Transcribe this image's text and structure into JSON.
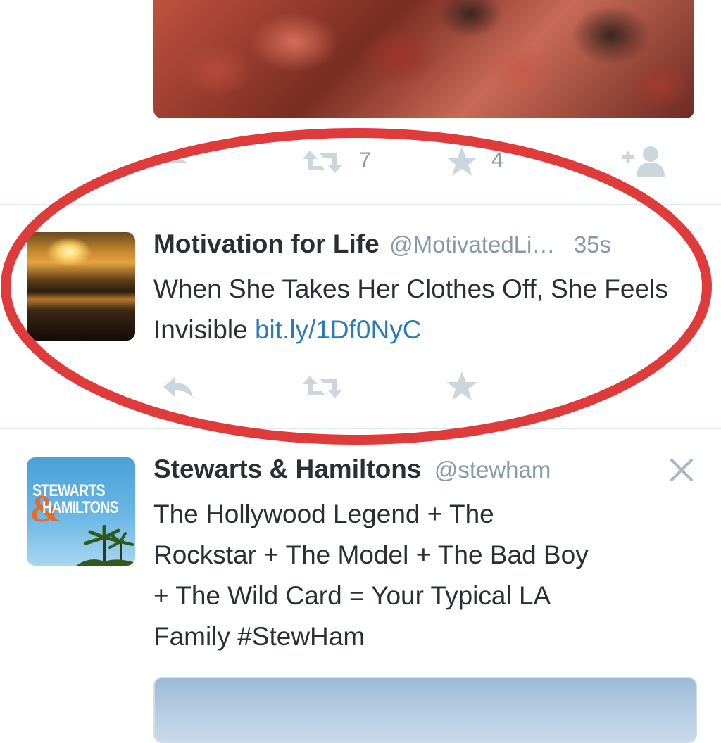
{
  "colors": {
    "accent_link": "#2b7bb9",
    "text_primary": "#292f33",
    "text_secondary": "#8899a6",
    "action_icon": "#ccd6dd",
    "divider": "#e1e8ed",
    "highlight_annotation": "#e03b3b"
  },
  "tweets": [
    {
      "media": "crowd-photo-image",
      "actions": {
        "reply": {
          "icon": "reply-icon",
          "count": ""
        },
        "retweet": {
          "icon": "retweet-icon",
          "count": "7"
        },
        "favorite": {
          "icon": "star-icon",
          "count": "4"
        },
        "follow": {
          "icon": "follow-icon"
        }
      }
    },
    {
      "author_name": "Motivation for Life",
      "handle": "@MotivatedLi…",
      "timestamp": "35s",
      "text": "When She Takes Her Clothes Off, She Feels Invisible",
      "link_text": "bit.ly/1Df0NyC",
      "avatar": "sunset-avatar",
      "actions": {
        "reply": {
          "icon": "reply-icon"
        },
        "retweet": {
          "icon": "retweet-icon"
        },
        "favorite": {
          "icon": "star-icon"
        }
      }
    },
    {
      "author_name": "Stewarts & Hamiltons",
      "handle": "@stewham",
      "dismiss_icon": "close-icon",
      "text_lines": [
        "The Hollywood Legend + The",
        "Rockstar + The Model + The Bad Boy",
        "+ The Wild Card = Your Typical LA",
        "Family #StewHam"
      ],
      "avatar": {
        "line1": "STEWARTS",
        "ampersand": "&",
        "line2": "HAMILTONS"
      },
      "media": "promoted-media-image"
    }
  ]
}
